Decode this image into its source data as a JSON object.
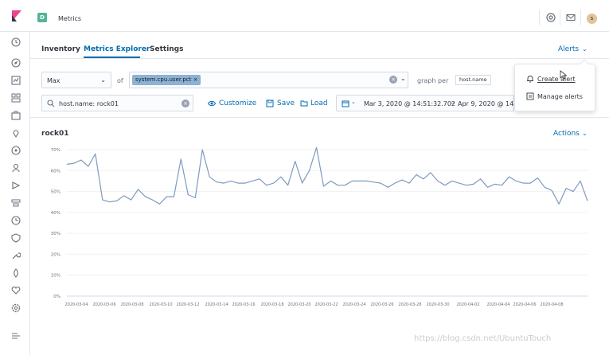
{
  "header": {
    "space_initial": "D",
    "app_title": "Metrics",
    "avatar_initial": "s"
  },
  "tabs": [
    {
      "label": "Inventory"
    },
    {
      "label": "Metrics Explorer"
    },
    {
      "label": "Settings"
    }
  ],
  "alerts": {
    "label": "Alerts",
    "menu": [
      {
        "label": "Create alert"
      },
      {
        "label": "Manage alerts"
      }
    ]
  },
  "toolbar": {
    "aggregation": "Max",
    "of_label": "of",
    "metric": "system.cpu.user.pct",
    "graph_per_label": "graph per",
    "group_by": "host.name",
    "search": "host.name: rock01",
    "customize": "Customize",
    "save": "Save",
    "load": "Load",
    "date_start": "Mar 3, 2020 @ 14:51:32.702",
    "date_end": "Apr 9, 2020 @ 14:52"
  },
  "chart": {
    "title": "rock01",
    "actions_label": "Actions"
  },
  "watermark": "https://blog.csdn.net/UbuntuTouch",
  "chart_data": {
    "type": "line",
    "title": "rock01",
    "ylim": [
      0,
      70
    ],
    "yticks": [
      "0%",
      "10%",
      "20%",
      "30%",
      "40%",
      "50%",
      "60%",
      "70%"
    ],
    "xticks": [
      "2020-03-04",
      "2020-03-06",
      "2020-03-08",
      "2020-03-10",
      "2020-03-12",
      "2020-03-14",
      "2020-03-16",
      "2020-03-18",
      "2020-03-20",
      "2020-03-22",
      "2020-03-24",
      "2020-03-26",
      "2020-03-28",
      "2020-03-30",
      "2020-04-02",
      "2020-04-04",
      "2020-04-06",
      "2020-04-08"
    ],
    "grid": true,
    "series": [
      {
        "color": "#7e9bbd",
        "values": [
          63,
          63.5,
          65,
          62,
          68,
          46,
          45,
          45.5,
          48,
          46,
          51,
          47.5,
          46,
          44,
          47.5,
          47.5,
          65.5,
          48.5,
          47,
          70,
          57,
          54.5,
          54,
          55,
          54,
          54,
          55,
          56,
          53,
          54,
          57,
          53,
          64.5,
          54,
          60,
          71,
          52.5,
          55,
          53,
          53,
          55,
          55,
          55,
          54.5,
          54,
          52,
          54,
          55.5,
          54,
          58,
          56,
          59,
          55,
          53,
          55,
          54,
          53,
          53.5,
          56,
          52,
          53.5,
          53,
          57,
          55,
          54,
          54,
          56.5,
          52,
          50.5,
          44,
          51.5,
          50,
          55,
          45.5
        ]
      }
    ]
  }
}
